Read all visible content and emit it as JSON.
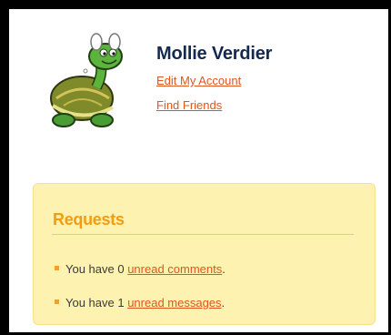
{
  "profile": {
    "name": "Mollie Verdier",
    "edit_account_link": "Edit My Account",
    "find_friends_link": "Find Friends",
    "avatar_icon": "turtle-avatar"
  },
  "requests": {
    "title": "Requests",
    "items": [
      {
        "prefix": "You have 0 ",
        "link_text": "unread comments",
        "suffix": "."
      },
      {
        "prefix": "You have 1 ",
        "link_text": "unread messages",
        "suffix": "."
      }
    ]
  },
  "colors": {
    "link": "#e2551c",
    "title_orange": "#f39c12",
    "name_navy": "#132a4e",
    "box_background": "#fdf2b0"
  }
}
